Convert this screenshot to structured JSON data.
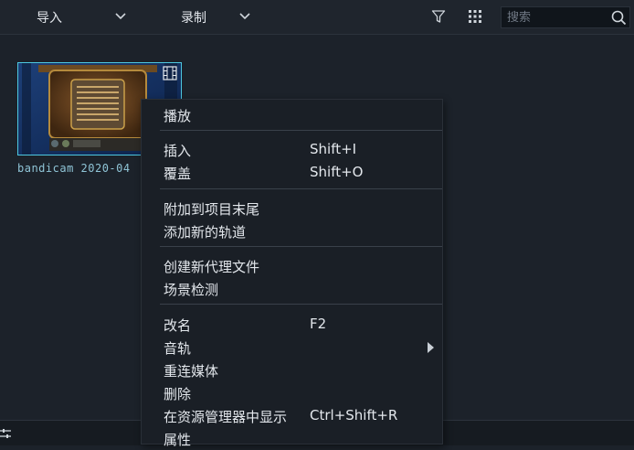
{
  "toolbar": {
    "import_label": "导入",
    "record_label": "录制",
    "search_placeholder": "搜索"
  },
  "media": {
    "clip_label": "bandicam 2020-04"
  },
  "context_menu": {
    "play": "播放",
    "insert": "插入",
    "insert_shortcut": "Shift+I",
    "overwrite": "覆盖",
    "overwrite_shortcut": "Shift+O",
    "append": "附加到项目末尾",
    "add_track": "添加新的轨道",
    "create_proxy": "创建新代理文件",
    "scene_detect": "场景检测",
    "rename": "改名",
    "rename_shortcut": "F2",
    "audio_track": "音轨",
    "relink": "重连媒体",
    "delete": "删除",
    "show_in_explorer": "在资源管理器中显示",
    "show_in_explorer_shortcut": "Ctrl+Shift+R",
    "properties": "属性"
  },
  "colors": {
    "background": "#1c222a",
    "menu_bg": "#1a1f26",
    "selection_border": "#4dc8e0",
    "text": "#e3e7ec"
  }
}
